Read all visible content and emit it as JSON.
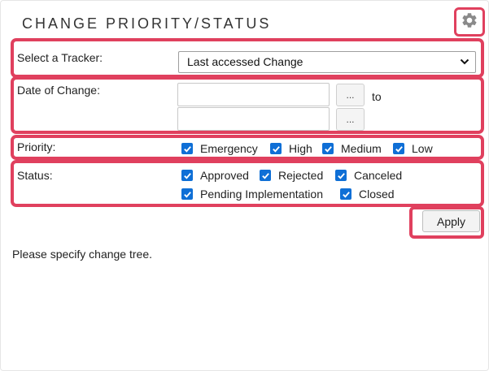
{
  "widget": {
    "title": "CHANGE PRIORITY/STATUS",
    "settings_icon": "gear-icon"
  },
  "tracker": {
    "label": "Select a Tracker:",
    "selected": "Last accessed Change"
  },
  "date": {
    "label": "Date of Change:",
    "from_value": "",
    "to_value": "",
    "picker_label": "...",
    "to_label": "to"
  },
  "priority": {
    "label": "Priority:",
    "options": [
      {
        "label": "Emergency",
        "checked": true
      },
      {
        "label": "High",
        "checked": true
      },
      {
        "label": "Medium",
        "checked": true
      },
      {
        "label": "Low",
        "checked": true
      }
    ]
  },
  "status": {
    "label": "Status:",
    "options": [
      {
        "label": "Approved",
        "checked": true
      },
      {
        "label": "Rejected",
        "checked": true
      },
      {
        "label": "Canceled",
        "checked": true
      },
      {
        "label": "Pending Implementation",
        "checked": true
      },
      {
        "label": "Closed",
        "checked": true
      }
    ]
  },
  "apply_label": "Apply",
  "message": "Please specify change tree.",
  "colors": {
    "highlight": "#e0405e",
    "checkbox": "#0f6fd6"
  }
}
